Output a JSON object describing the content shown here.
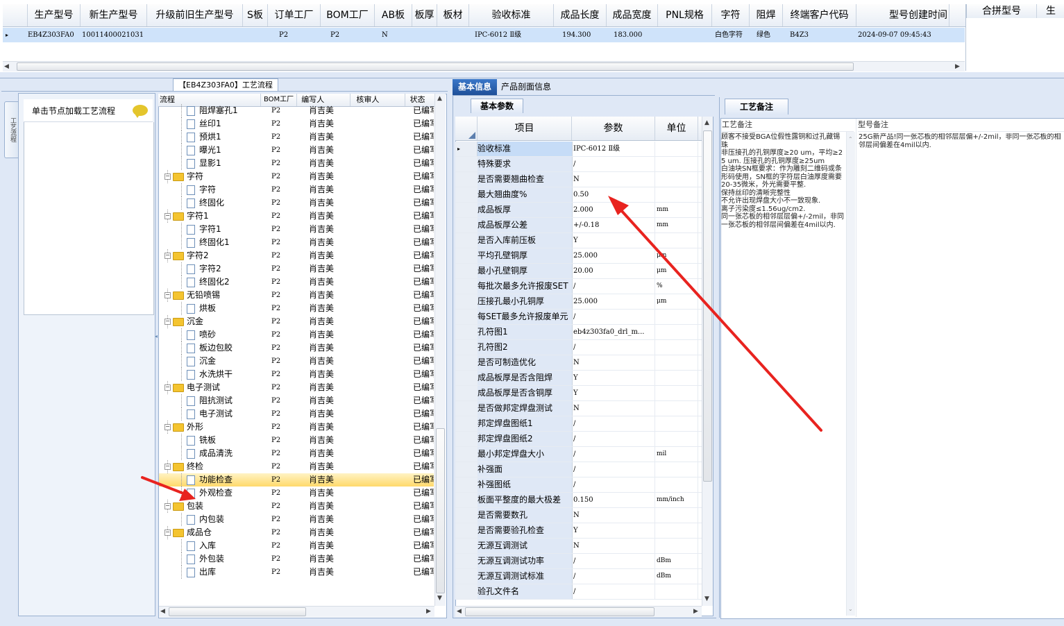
{
  "top_grid": {
    "columns": [
      "生产型号",
      "新生产型号",
      "升级前旧生产型号",
      "S板",
      "订单工厂",
      "BOM工厂",
      "AB板",
      "板厚",
      "板材",
      "验收标准",
      "成品长度",
      "成品宽度",
      "PNL规格",
      "字符",
      "阻焊",
      "终端客户代码",
      "型号创建时间"
    ],
    "row": {
      "生产型号": "EB4Z303FA0",
      "新生产型号": "10011400021031",
      "订单工厂": "P2",
      "BOM工厂": "P2",
      "AB板": "N",
      "验收标准": "IPC-6012 Ⅱ级",
      "成品长度": "194.300",
      "成品宽度": "183.000",
      "字符": "白色字符",
      "阻焊": "绿色",
      "终端客户代码": "B4Z3",
      "型号创建时间": "2024-09-07 09:45:43"
    },
    "right_columns": [
      "合拼型号",
      "生"
    ]
  },
  "flow_panel": {
    "title": "【EB4Z303FA0】工艺流程",
    "side_tab": "工艺流程",
    "side_header": "单击节点加载工艺流程",
    "tree_columns": [
      "流程",
      "BOM工厂",
      "编写人",
      "核审人",
      "状态"
    ],
    "rows": [
      {
        "label": "阻焊塞孔1",
        "type": "doc",
        "level": 2,
        "bom": "P2",
        "writer": "肖吉美",
        "status": "已编写"
      },
      {
        "label": "丝印1",
        "type": "doc",
        "level": 2,
        "bom": "P2",
        "writer": "肖吉美",
        "status": "已编写"
      },
      {
        "label": "预烘1",
        "type": "doc",
        "level": 2,
        "bom": "P2",
        "writer": "肖吉美",
        "status": "已编写"
      },
      {
        "label": "曝光1",
        "type": "doc",
        "level": 2,
        "bom": "P2",
        "writer": "肖吉美",
        "status": "已编写"
      },
      {
        "label": "显影1",
        "type": "doc",
        "level": 2,
        "bom": "P2",
        "writer": "肖吉美",
        "status": "已编写"
      },
      {
        "label": "字符",
        "type": "folder",
        "level": 1,
        "bom": "P2",
        "writer": "肖吉美",
        "status": "已编写"
      },
      {
        "label": "字符",
        "type": "doc",
        "level": 2,
        "bom": "P2",
        "writer": "肖吉美",
        "status": "已编写"
      },
      {
        "label": "终固化",
        "type": "doc",
        "level": 2,
        "bom": "P2",
        "writer": "肖吉美",
        "status": "已编写"
      },
      {
        "label": "字符1",
        "type": "folder",
        "level": 1,
        "bom": "P2",
        "writer": "肖吉美",
        "status": "已编写"
      },
      {
        "label": "字符1",
        "type": "doc",
        "level": 2,
        "bom": "P2",
        "writer": "肖吉美",
        "status": "已编写"
      },
      {
        "label": "终固化1",
        "type": "doc",
        "level": 2,
        "bom": "P2",
        "writer": "肖吉美",
        "status": "已编写"
      },
      {
        "label": "字符2",
        "type": "folder",
        "level": 1,
        "bom": "P2",
        "writer": "肖吉美",
        "status": "已编写"
      },
      {
        "label": "字符2",
        "type": "doc",
        "level": 2,
        "bom": "P2",
        "writer": "肖吉美",
        "status": "已编写"
      },
      {
        "label": "终固化2",
        "type": "doc",
        "level": 2,
        "bom": "P2",
        "writer": "肖吉美",
        "status": "已编写"
      },
      {
        "label": "无铅喷锡",
        "type": "folder",
        "level": 1,
        "bom": "P2",
        "writer": "肖吉美",
        "status": "已编写"
      },
      {
        "label": "烘板",
        "type": "doc",
        "level": 2,
        "bom": "P2",
        "writer": "肖吉美",
        "status": "已编写"
      },
      {
        "label": "沉金",
        "type": "folder",
        "level": 1,
        "bom": "P2",
        "writer": "肖吉美",
        "status": "已编写"
      },
      {
        "label": "喷砂",
        "type": "doc",
        "level": 2,
        "bom": "P2",
        "writer": "肖吉美",
        "status": "已编写"
      },
      {
        "label": "板边包胶",
        "type": "doc",
        "level": 2,
        "bom": "P2",
        "writer": "肖吉美",
        "status": "已编写"
      },
      {
        "label": "沉金",
        "type": "doc",
        "level": 2,
        "bom": "P2",
        "writer": "肖吉美",
        "status": "已编写"
      },
      {
        "label": "水洗烘干",
        "type": "doc",
        "level": 2,
        "bom": "P2",
        "writer": "肖吉美",
        "status": "已编写"
      },
      {
        "label": "电子测试",
        "type": "folder",
        "level": 1,
        "bom": "P2",
        "writer": "肖吉美",
        "status": "已编写"
      },
      {
        "label": "阻抗测试",
        "type": "doc",
        "level": 2,
        "bom": "P2",
        "writer": "肖吉美",
        "status": "已编写"
      },
      {
        "label": "电子测试",
        "type": "doc",
        "level": 2,
        "bom": "P2",
        "writer": "肖吉美",
        "status": "已编写"
      },
      {
        "label": "外形",
        "type": "folder",
        "level": 1,
        "bom": "P2",
        "writer": "肖吉美",
        "status": "已编写"
      },
      {
        "label": "铣板",
        "type": "doc",
        "level": 2,
        "bom": "P2",
        "writer": "肖吉美",
        "status": "已编写"
      },
      {
        "label": "成品清洗",
        "type": "doc",
        "level": 2,
        "bom": "P2",
        "writer": "肖吉美",
        "status": "已编写"
      },
      {
        "label": "终检",
        "type": "folder",
        "level": 1,
        "bom": "P2",
        "writer": "肖吉美",
        "status": "已编写"
      },
      {
        "label": "功能检查",
        "type": "doc",
        "level": 2,
        "bom": "P2",
        "writer": "肖吉美",
        "status": "已编写",
        "selected": true
      },
      {
        "label": "外观检查",
        "type": "doc",
        "level": 2,
        "bom": "P2",
        "writer": "肖吉美",
        "status": "已编写"
      },
      {
        "label": "包装",
        "type": "folder",
        "level": 1,
        "bom": "P2",
        "writer": "肖吉美",
        "status": "已编写"
      },
      {
        "label": "内包装",
        "type": "doc",
        "level": 2,
        "bom": "P2",
        "writer": "肖吉美",
        "status": "已编写"
      },
      {
        "label": "成品仓",
        "type": "folder",
        "level": 1,
        "bom": "P2",
        "writer": "肖吉美",
        "status": "已编写"
      },
      {
        "label": "入库",
        "type": "doc",
        "level": 2,
        "bom": "P2",
        "writer": "肖吉美",
        "status": "已编写"
      },
      {
        "label": "外包装",
        "type": "doc",
        "level": 2,
        "bom": "P2",
        "writer": "肖吉美",
        "status": "已编写"
      },
      {
        "label": "出库",
        "type": "doc",
        "level": 2,
        "bom": "P2",
        "writer": "肖吉美",
        "status": "已编写"
      }
    ]
  },
  "middle_panel": {
    "tabs": [
      "基本信息",
      "产品剖面信息"
    ],
    "subtab": "基本参数",
    "columns": [
      "项目",
      "参数",
      "单位"
    ],
    "rows": [
      {
        "item": "验收标准",
        "param": "IPC-6012 Ⅱ级",
        "unit": ""
      },
      {
        "item": "特殊要求",
        "param": "/",
        "unit": ""
      },
      {
        "item": "是否需要翘曲检查",
        "param": "N",
        "unit": ""
      },
      {
        "item": "最大翘曲度%",
        "param": "0.50",
        "unit": ""
      },
      {
        "item": "成品板厚",
        "param": "2.000",
        "unit": "mm"
      },
      {
        "item": "成品板厚公差",
        "param": "+/-0.18",
        "unit": "mm"
      },
      {
        "item": "是否入库前压板",
        "param": "Y",
        "unit": ""
      },
      {
        "item": "平均孔壁铜厚",
        "param": "25.000",
        "unit": "μm"
      },
      {
        "item": "最小孔壁铜厚",
        "param": "20.00",
        "unit": "μm"
      },
      {
        "item": "每批次最多允许报废SET",
        "param": "/",
        "unit": "%"
      },
      {
        "item": "压接孔最小孔铜厚",
        "param": "25.000",
        "unit": "μm"
      },
      {
        "item": "每SET最多允许报废单元",
        "param": "/",
        "unit": ""
      },
      {
        "item": "孔符图1",
        "param": "eb4z303fa0_drl_m...",
        "unit": ""
      },
      {
        "item": "孔符图2",
        "param": "/",
        "unit": ""
      },
      {
        "item": "是否可制造优化",
        "param": "N",
        "unit": ""
      },
      {
        "item": "成品板厚是否含阻焊",
        "param": "Y",
        "unit": ""
      },
      {
        "item": "成品板厚是否含铜厚",
        "param": "Y",
        "unit": ""
      },
      {
        "item": "是否做邦定焊盘测试",
        "param": "N",
        "unit": ""
      },
      {
        "item": "邦定焊盘图纸1",
        "param": "/",
        "unit": ""
      },
      {
        "item": "邦定焊盘图纸2",
        "param": "/",
        "unit": ""
      },
      {
        "item": "最小邦定焊盘大小",
        "param": "/",
        "unit": "mil"
      },
      {
        "item": "补强面",
        "param": "/",
        "unit": ""
      },
      {
        "item": "补强图纸",
        "param": "/",
        "unit": ""
      },
      {
        "item": "板面平整度的最大极差",
        "param": "0.150",
        "unit": "mm/inch"
      },
      {
        "item": "是否需要数孔",
        "param": "N",
        "unit": ""
      },
      {
        "item": "是否需要验孔检查",
        "param": "Y",
        "unit": ""
      },
      {
        "item": "无源互调测试",
        "param": "N",
        "unit": ""
      },
      {
        "item": "无源互调测试功率",
        "param": "/",
        "unit": "dBm"
      },
      {
        "item": "无源互调测试标准",
        "param": "/",
        "unit": "dBm"
      },
      {
        "item": "验孔文件名",
        "param": "/",
        "unit": ""
      }
    ]
  },
  "right_panel": {
    "tab": "工艺备注",
    "col1": "工艺备注",
    "col2": "型号备注",
    "process_remark": "顾客不接受BGA位假性露铜和过孔藏锡珠\n非压接孔的孔铜厚度≥20 um，平均≥25 um. 压接孔的孔铜厚度≥25um\n白油块SN框要求：作为雕刻二维码或条形码使用，SN框的字符层白油厚度需要20-35微米，外光需要平整.\n保持丝印的清晰完整性\n不允许出现焊盘大小不一致现象.\n离子污染度≤1.56ug/cm2.\n同一张芯板的相邻层层偏+/-2mil，非同一张芯板的相邻层间偏差在4mil以内.",
    "model_remark": "25G新产品!同一张芯板的相邻层层偏+/-2mil，非同一张芯板的相邻层间偏差在4mil以内."
  },
  "colors": {
    "accent": "#1e4f98",
    "selection": "#ffd96b",
    "row_highlight": "#cfe3fa",
    "annotation_arrow": "#e8231f"
  }
}
